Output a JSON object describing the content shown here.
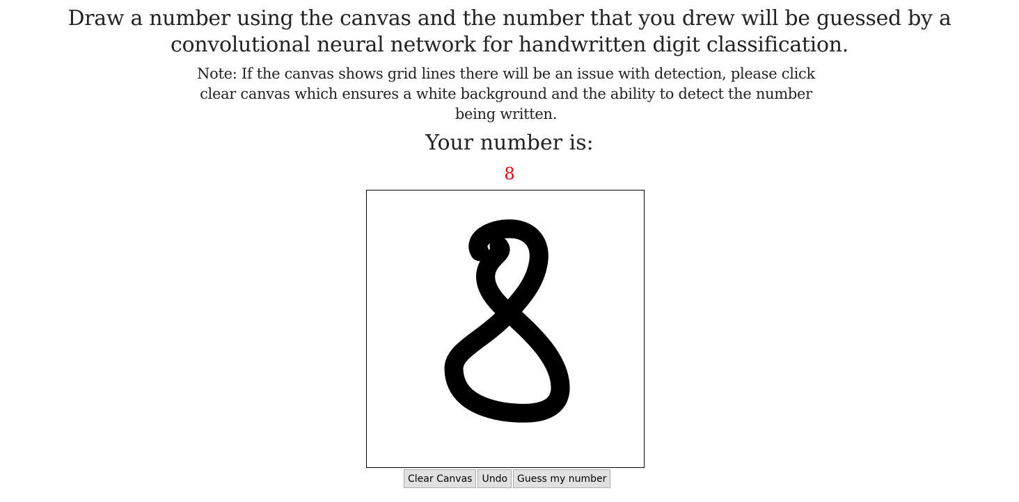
{
  "headline": "Draw a number using the canvas and the number that you drew will be guessed by a convolutional neural network for handwritten digit classification.",
  "note": "Note: If the canvas shows grid lines there will be an issue with detection, please click clear canvas which ensures a white background and the ability to detect the number being written.",
  "result": {
    "label": "Your number is:",
    "value": "8",
    "value_color": "#e8000b"
  },
  "controls": {
    "clear_label": "Clear Canvas",
    "undo_label": "Undo",
    "guess_label": "Guess my number"
  }
}
